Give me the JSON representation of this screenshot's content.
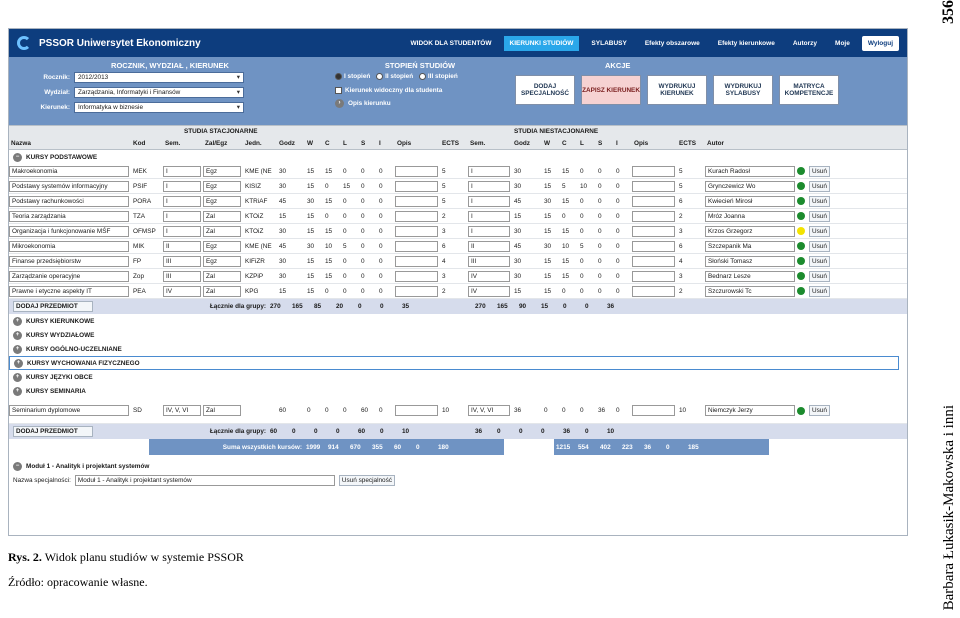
{
  "page_no": "356",
  "page_author": "Barbara Łukasik-Makowska i inni",
  "app": {
    "title": "PSSOR Uniwersytet Ekonomiczny",
    "nav": [
      "WIDOK DLA STUDENTÓW",
      "KIERUNKI STUDIÓW",
      "SYLABUSY",
      "Efekty obszarowe",
      "Efekty kierunkowe",
      "Autorzy",
      "Moje",
      "Wyloguj"
    ]
  },
  "head": {
    "sec1": "ROCZNIK, WYDZIAŁ , KIERUNEK",
    "rocznik_label": "Rocznik:",
    "rocznik": "2012/2013",
    "wydzial_label": "Wydział:",
    "wydzial": "Zarządzania, Informatyki i Finansów",
    "kierunek_label": "Kierunek:",
    "kierunek": "Informatyka w biznesie",
    "sec2": "STOPIEŃ STUDIÓW",
    "radios": [
      "I stopień",
      "II stopień",
      "III stopień"
    ],
    "check": "Kierunek widoczny dla studenta",
    "opis": "Opis kierunku",
    "sec3": "AKCJE",
    "actions": [
      "DODAJ SPECJALNOŚĆ",
      "ZAPISZ KIERUNEK",
      "WYDRUKUJ KIERUNEK",
      "WYDRUKUJ SYLABUSY",
      "MATRYCA KOMPETENCJE"
    ]
  },
  "table": {
    "groups_top": [
      "STUDIA STACJONARNE",
      "STUDIA NIESTACJONARNE"
    ],
    "cols": [
      "Nazwa",
      "Kod",
      "Sem.",
      "Zal/Egz",
      "Jedn.",
      "Godz",
      "W",
      "C",
      "L",
      "S",
      "I",
      "Opis",
      "ECTS",
      "Sem.",
      "Godz",
      "W",
      "C",
      "L",
      "S",
      "I",
      "Opis",
      "ECTS",
      "Autor"
    ],
    "group_basic": "KURSY PODSTAWOWE",
    "rows": [
      {
        "n": "Makroekonomia",
        "k": "MEK",
        "s": "I",
        "z": "Egz",
        "j": "KME (NE",
        "g": "30",
        "w": "15",
        "c": "15",
        "l": "0",
        "ss": "0",
        "i": "0",
        "e": "5",
        "s2": "I",
        "g2": "30",
        "w2": "15",
        "c2": "15",
        "l2": "0",
        "s22": "0",
        "i2": "0",
        "e2": "5",
        "a": "Kurach Radosł",
        "dot": "g"
      },
      {
        "n": "Podstawy systemów informacyjny",
        "k": "PSIF",
        "s": "I",
        "z": "Egz",
        "j": "KISIZ",
        "g": "30",
        "w": "15",
        "c": "0",
        "l": "15",
        "ss": "0",
        "i": "0",
        "e": "5",
        "s2": "I",
        "g2": "30",
        "w2": "15",
        "c2": "5",
        "l2": "10",
        "s22": "0",
        "i2": "0",
        "e2": "5",
        "a": "Grynczewicz Wo",
        "dot": "g"
      },
      {
        "n": "Podstawy rachunkowości",
        "k": "PORA",
        "s": "I",
        "z": "Egz",
        "j": "KTRiAF",
        "g": "45",
        "w": "30",
        "c": "15",
        "l": "0",
        "ss": "0",
        "i": "0",
        "e": "5",
        "s2": "I",
        "g2": "45",
        "w2": "30",
        "c2": "15",
        "l2": "0",
        "s22": "0",
        "i2": "0",
        "e2": "6",
        "a": "Kwiecień Mirosł",
        "dot": "g"
      },
      {
        "n": "Teoria zarządzania",
        "k": "TZA",
        "s": "I",
        "z": "Zal",
        "j": "KTOiZ",
        "g": "15",
        "w": "15",
        "c": "0",
        "l": "0",
        "ss": "0",
        "i": "0",
        "e": "2",
        "s2": "I",
        "g2": "15",
        "w2": "15",
        "c2": "0",
        "l2": "0",
        "s22": "0",
        "i2": "0",
        "e2": "2",
        "a": "Mróz Joanna",
        "dot": "g"
      },
      {
        "n": "Organizacja i funkcjonowanie MŚF",
        "k": "OFMSP",
        "s": "I",
        "z": "Zal",
        "j": "KTOiZ",
        "g": "30",
        "w": "15",
        "c": "15",
        "l": "0",
        "ss": "0",
        "i": "0",
        "e": "3",
        "s2": "I",
        "g2": "30",
        "w2": "15",
        "c2": "15",
        "l2": "0",
        "s22": "0",
        "i2": "0",
        "e2": "3",
        "a": "Krzos Grzegorz",
        "dot": "y"
      },
      {
        "n": "Mikroekonomia",
        "k": "MIK",
        "s": "II",
        "z": "Egz",
        "j": "KME (NE",
        "g": "45",
        "w": "30",
        "c": "10",
        "l": "5",
        "ss": "0",
        "i": "0",
        "e": "6",
        "s2": "II",
        "g2": "45",
        "w2": "30",
        "c2": "10",
        "l2": "5",
        "s22": "0",
        "i2": "0",
        "e2": "6",
        "a": "Szczepanik Ma",
        "dot": "g"
      },
      {
        "n": "Finanse przedsiębiorstw",
        "k": "FP",
        "s": "III",
        "z": "Egz",
        "j": "KIFiZR",
        "g": "30",
        "w": "15",
        "c": "15",
        "l": "0",
        "ss": "0",
        "i": "0",
        "e": "4",
        "s2": "III",
        "g2": "30",
        "w2": "15",
        "c2": "15",
        "l2": "0",
        "s22": "0",
        "i2": "0",
        "e2": "4",
        "a": "Słoński Tomasz",
        "dot": "g"
      },
      {
        "n": "Zarządzanie operacyjne",
        "k": "Zop",
        "s": "III",
        "z": "Zal",
        "j": "KZPiP",
        "g": "30",
        "w": "15",
        "c": "15",
        "l": "0",
        "ss": "0",
        "i": "0",
        "e": "3",
        "s2": "IV",
        "g2": "30",
        "w2": "15",
        "c2": "15",
        "l2": "0",
        "s22": "0",
        "i2": "0",
        "e2": "3",
        "a": "Bednarz Lesze",
        "dot": "g"
      },
      {
        "n": "Prawne i etyczne aspekty IT",
        "k": "PEA",
        "s": "IV",
        "z": "Zal",
        "j": "KPG",
        "g": "15",
        "w": "15",
        "c": "0",
        "l": "0",
        "ss": "0",
        "i": "0",
        "e": "2",
        "s2": "IV",
        "g2": "15",
        "w2": "15",
        "c2": "0",
        "l2": "0",
        "s22": "0",
        "i2": "0",
        "e2": "2",
        "a": "Szczurowski Tc",
        "dot": "g"
      }
    ],
    "add_btn": "DODAJ PRZEDMIOT",
    "sum_label": "Łącznie dla grupy:",
    "sum_basic": [
      "270",
      "165",
      "85",
      "20",
      "0",
      "0",
      "35",
      "270",
      "165",
      "90",
      "15",
      "0",
      "0",
      "36"
    ],
    "other_groups": [
      "KURSY KIERUNKOWE",
      "KURSY WYDZIAŁOWE",
      "KURSY OGÓLNO-UCZELNIANE",
      "KURSY WYCHOWANIA FIZYCZNEGO",
      "KURSY JĘZYKI OBCE",
      "KURSY SEMINARIA"
    ],
    "seminar": {
      "n": "Seminarium dyplomowe",
      "k": "SD",
      "s": "IV, V, VI",
      "z": "Zal",
      "g": "60",
      "w": "0",
      "c": "0",
      "l": "0",
      "ss": "60",
      "i": "0",
      "e": "10",
      "s2": "IV, V, VI",
      "g2": "36",
      "w2": "0",
      "c2": "0",
      "l2": "0",
      "s22": "36",
      "i2": "0",
      "e2": "10",
      "a": "Niemczyk Jerzy"
    },
    "sum_sem": [
      "60",
      "0",
      "0",
      "0",
      "60",
      "0",
      "10",
      "36",
      "0",
      "0",
      "0",
      "36",
      "0",
      "10"
    ],
    "grand_label": "Suma wszystkich kursów:",
    "grand": [
      "1999",
      "914",
      "670",
      "355",
      "60",
      "0",
      "180",
      "1215",
      "554",
      "402",
      "223",
      "36",
      "0",
      "185"
    ],
    "usun": "Usuń"
  },
  "spec": {
    "module": "Moduł 1 - Analityk i projektant systemów",
    "label": "Nazwa specjalności:",
    "value": "Moduł 1 - Analityk i projektant systemów",
    "btn": "Usuń specjalność"
  },
  "caption": {
    "title": "Rys. 2.",
    "text": " Widok planu studiów w systemie PSSOR",
    "source": "Źródło: opracowanie własne."
  }
}
